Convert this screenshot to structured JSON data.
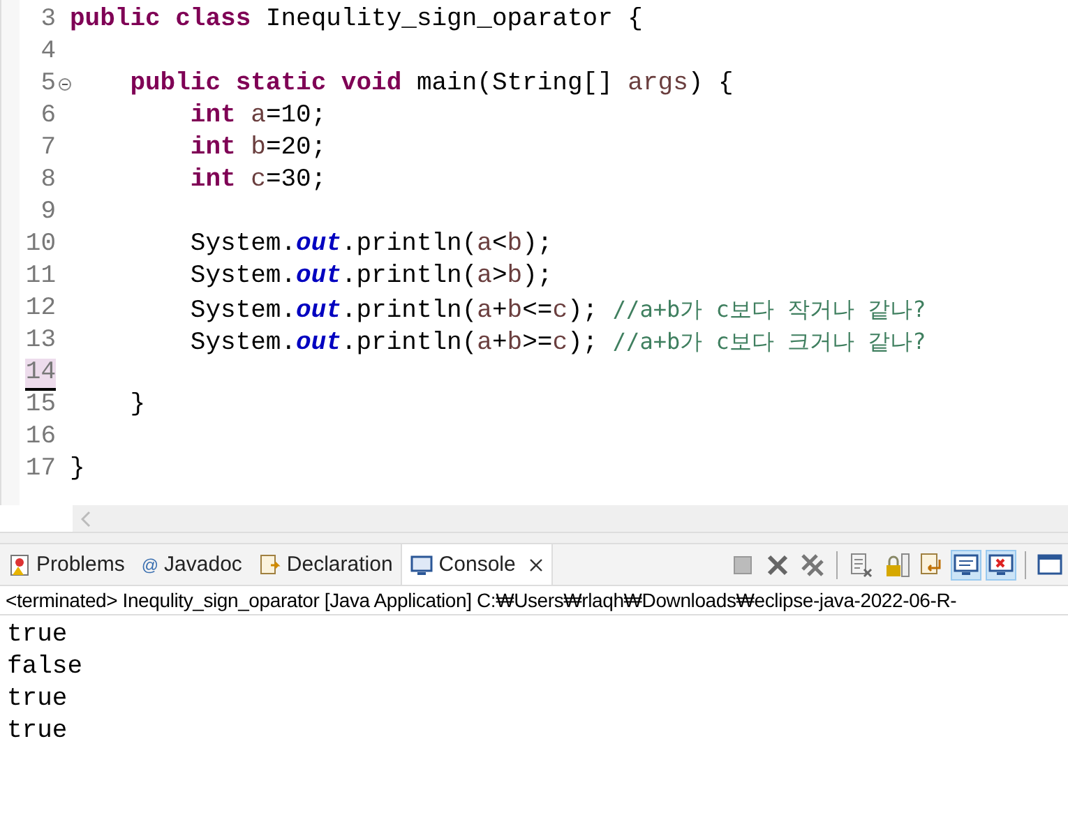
{
  "editor": {
    "lines": [
      {
        "number": "3",
        "current": false,
        "tokens": [
          {
            "kind": "keyword",
            "text": "public class"
          },
          {
            "kind": "plain",
            "text": " Inequlity_sign_oparator {"
          }
        ]
      },
      {
        "number": "4",
        "current": false
      },
      {
        "number": "5",
        "current": false,
        "fold": true,
        "tokens": [
          {
            "kind": "keyword",
            "text": "    public static void"
          },
          {
            "kind": "plain",
            "text": " main(String[] "
          },
          {
            "kind": "variable",
            "text": "args"
          },
          {
            "kind": "plain",
            "text": ") {"
          }
        ]
      },
      {
        "number": "6",
        "current": false,
        "tokens": [
          {
            "kind": "keyword",
            "text": "        int"
          },
          {
            "kind": "variable",
            "text": " a"
          },
          {
            "kind": "plain",
            "text": "=10;"
          }
        ]
      },
      {
        "number": "7",
        "current": false,
        "tokens": [
          {
            "kind": "keyword",
            "text": "        int"
          },
          {
            "kind": "variable",
            "text": " b"
          },
          {
            "kind": "plain",
            "text": "=20;"
          }
        ]
      },
      {
        "number": "8",
        "current": false,
        "tokens": [
          {
            "kind": "keyword",
            "text": "        int"
          },
          {
            "kind": "variable",
            "text": " c"
          },
          {
            "kind": "plain",
            "text": "=30;"
          }
        ]
      },
      {
        "number": "9",
        "current": false
      },
      {
        "number": "10",
        "current": false,
        "tokens": [
          {
            "kind": "plain",
            "text": "        System."
          },
          {
            "kind": "field",
            "text": "out"
          },
          {
            "kind": "plain",
            "text": ".println("
          },
          {
            "kind": "variable",
            "text": "a"
          },
          {
            "kind": "plain",
            "text": "<"
          },
          {
            "kind": "variable",
            "text": "b"
          },
          {
            "kind": "plain",
            "text": ");"
          }
        ]
      },
      {
        "number": "11",
        "current": false,
        "tokens": [
          {
            "kind": "plain",
            "text": "        System."
          },
          {
            "kind": "field",
            "text": "out"
          },
          {
            "kind": "plain",
            "text": ".println("
          },
          {
            "kind": "variable",
            "text": "a"
          },
          {
            "kind": "plain",
            "text": ">"
          },
          {
            "kind": "variable",
            "text": "b"
          },
          {
            "kind": "plain",
            "text": ");"
          }
        ]
      },
      {
        "number": "12",
        "current": false,
        "tokens": [
          {
            "kind": "plain",
            "text": "        System."
          },
          {
            "kind": "field",
            "text": "out"
          },
          {
            "kind": "plain",
            "text": ".println("
          },
          {
            "kind": "variable",
            "text": "a"
          },
          {
            "kind": "plain",
            "text": "+"
          },
          {
            "kind": "variable",
            "text": "b"
          },
          {
            "kind": "plain",
            "text": "<="
          },
          {
            "kind": "variable",
            "text": "c"
          },
          {
            "kind": "plain",
            "text": "); "
          },
          {
            "kind": "comment",
            "text": "//a+b가 c보다 작거나 같나?"
          }
        ]
      },
      {
        "number": "13",
        "current": false,
        "tokens": [
          {
            "kind": "plain",
            "text": "        System."
          },
          {
            "kind": "field",
            "text": "out"
          },
          {
            "kind": "plain",
            "text": ".println("
          },
          {
            "kind": "variable",
            "text": "a"
          },
          {
            "kind": "plain",
            "text": "+"
          },
          {
            "kind": "variable",
            "text": "b"
          },
          {
            "kind": "plain",
            "text": ">="
          },
          {
            "kind": "variable",
            "text": "c"
          },
          {
            "kind": "plain",
            "text": "); "
          },
          {
            "kind": "comment",
            "text": "//a+b가 c보다 크거나 같나?"
          }
        ]
      },
      {
        "number": "14",
        "current": true
      },
      {
        "number": "15",
        "current": false,
        "tokens": [
          {
            "kind": "plain",
            "text": "    }"
          }
        ]
      },
      {
        "number": "16",
        "current": false
      },
      {
        "number": "17",
        "current": false,
        "tokens": [
          {
            "kind": "plain",
            "text": "}"
          }
        ]
      }
    ]
  },
  "tabs": [
    {
      "label": "Problems",
      "selected": false
    },
    {
      "label": "Javadoc",
      "icon": "@",
      "selected": false
    },
    {
      "label": "Declaration",
      "selected": false
    },
    {
      "label": "Console",
      "selected": true,
      "closable": true
    }
  ],
  "toolbar": [
    {
      "kind": "stop",
      "on": false
    },
    {
      "kind": "remove",
      "on": false
    },
    {
      "kind": "remove-all",
      "on": false
    },
    {
      "kind": "sep"
    },
    {
      "kind": "clear",
      "on": false
    },
    {
      "kind": "lock",
      "on": false
    },
    {
      "kind": "wrap",
      "on": false
    },
    {
      "kind": "show-out",
      "on": true
    },
    {
      "kind": "show-err",
      "on": true
    },
    {
      "kind": "sep"
    },
    {
      "kind": "console",
      "on": false
    }
  ],
  "console": {
    "header": "<terminated> Inequlity_sign_oparator [Java Application] C:₩Users₩rlaqh₩Downloads₩eclipse-java-2022-06-R-",
    "output": [
      "true",
      "false",
      "true",
      "true"
    ]
  }
}
